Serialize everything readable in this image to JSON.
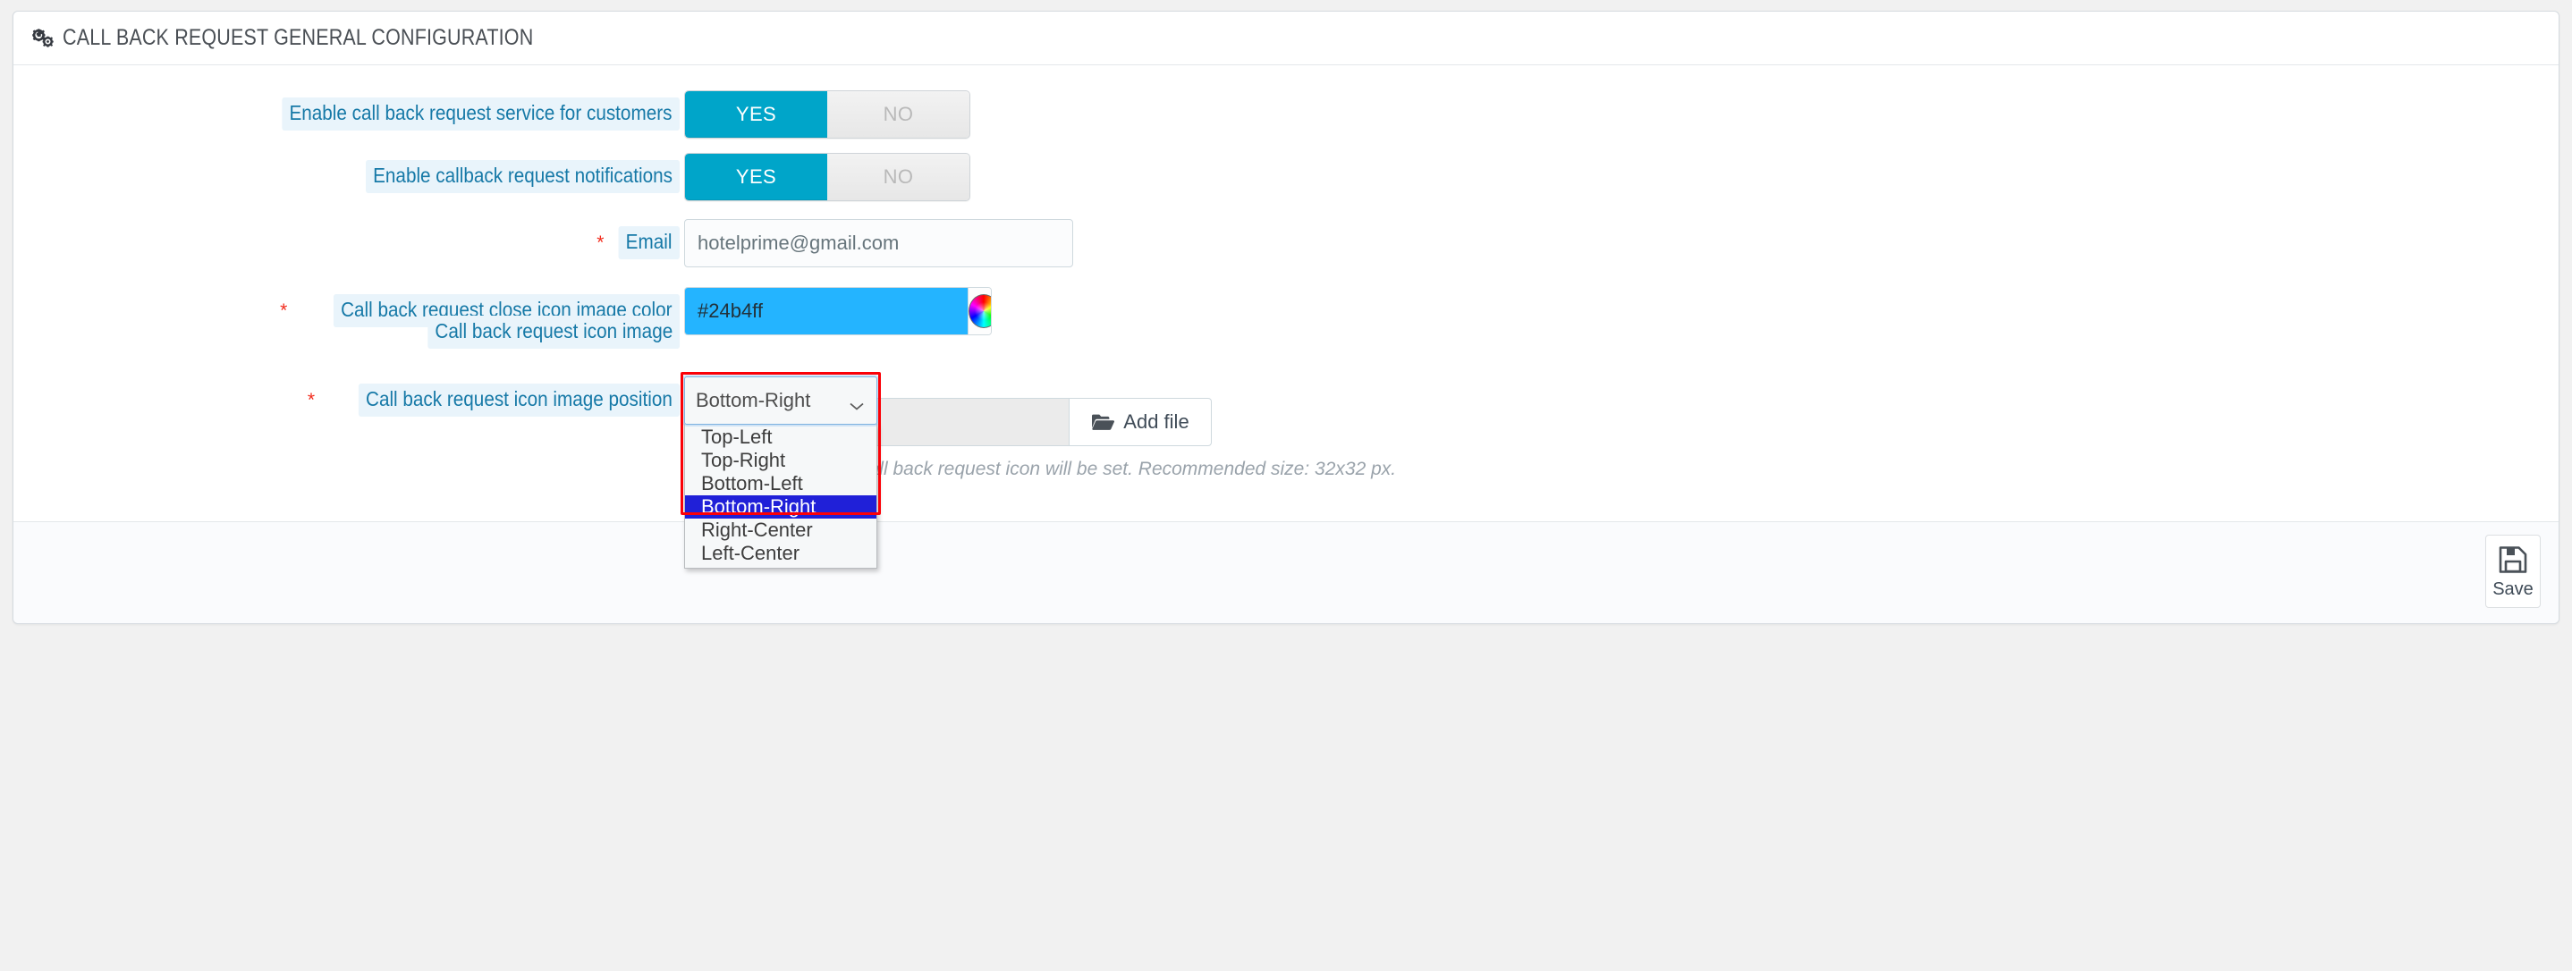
{
  "header": {
    "icon": "cogs-icon",
    "title": "CALL BACK REQUEST GENERAL CONFIGURATION"
  },
  "form": {
    "rows": [
      {
        "label": "Enable call back request service for customers",
        "required": false,
        "type": "switch",
        "yes_label": "YES",
        "no_label": "NO",
        "value": "YES"
      },
      {
        "label": "Enable callback request notifications",
        "required": false,
        "type": "switch",
        "yes_label": "YES",
        "no_label": "NO",
        "value": "YES"
      },
      {
        "label": "Email",
        "required": true,
        "type": "text",
        "value": "hotelprime@gmail.com"
      },
      {
        "label": "Call back request close icon image color",
        "required": true,
        "type": "color",
        "value": "#24b4ff",
        "swatch_icon": "color-wheel-icon"
      },
      {
        "label": "Call back request icon image position",
        "required": true,
        "type": "select",
        "value": "Bottom-Right",
        "options": [
          "Top-Left",
          "Top-Right",
          "Bottom-Left",
          "Bottom-Right",
          "Right-Center",
          "Left-Center"
        ]
      },
      {
        "label": "Call back request icon image",
        "required": false,
        "type": "file",
        "file_name": "",
        "add_file_label": "Add file",
        "add_file_icon": "folder-open-icon",
        "help": "If not set, the default call back request icon will be set. Recommended size: 32x32 px."
      }
    ]
  },
  "footer": {
    "save_label": "Save",
    "save_icon": "floppy-disk-icon"
  },
  "colors": {
    "accent": "#00a5c9",
    "label_text": "#1679a7",
    "label_bg": "#e9f4fb",
    "required_star": "#f22c1d",
    "color_value": "#24b4ff",
    "option_highlight": "#2020d8",
    "annotation_outline": "#fb0007",
    "page_bg": "#f1f1f1"
  }
}
